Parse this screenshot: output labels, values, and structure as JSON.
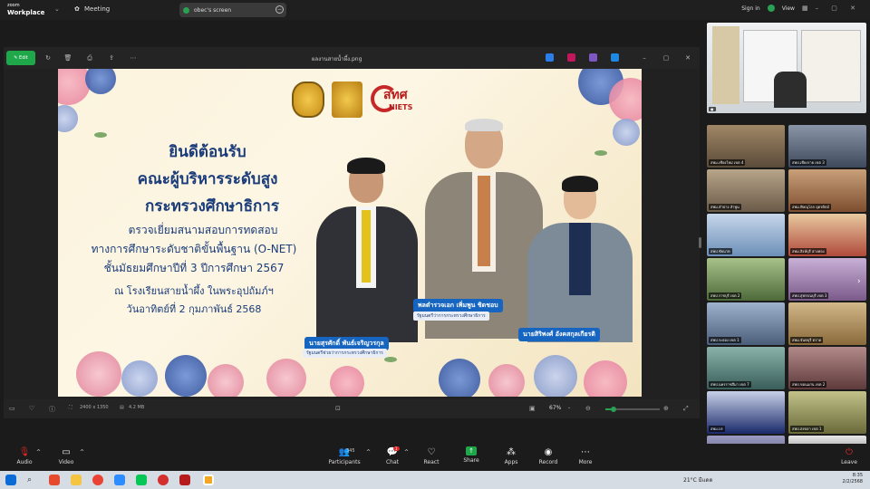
{
  "app": {
    "logo_top": "zoom",
    "logo_name": "Workplace",
    "meeting_label": "Meeting",
    "screen_chip": "obec's screen",
    "sign_in": "Sign in",
    "view": "View"
  },
  "viewer": {
    "edit_label": "Edit",
    "file_title": "ผลงานสายน้ำผึ้ง.png",
    "dimensions": "2400 x 1350",
    "file_size": "4.2 MB",
    "zoom_level": "67%"
  },
  "slide": {
    "line1": "ยินดีต้อนรับ",
    "line2": "คณะผู้บริหารระดับสูง",
    "line3": "กระทรวงศึกษาธิการ",
    "line4": "ตรวจเยี่ยมสนามสอบการทดสอบ",
    "line5": "ทางการศึกษาระดับชาติขั้นพื้นฐาน (O-NET)",
    "line6": "ชั้นมัธยมศึกษาปีที่ 3 ปีการศึกษา 2567",
    "line7": "ณ โรงเรียนสายน้ำผึ้ง ในพระอุปถัมภ์ฯ",
    "line8": "วันอาทิตย์ที่ 2 กุมภาพันธ์ 2568",
    "niets_thai": "สทศ",
    "niets_en": "NIETS",
    "people": [
      {
        "name": "นายสุรศักดิ์ พันธ์เจริญวรกุล",
        "role": "รัฐมนตรีช่วยว่าการกระทรวงศึกษาธิการ"
      },
      {
        "name": "พลตำรวจเอก เพิ่มพูน ชิดชอบ",
        "role": "รัฐมนตรีว่าการกระทรวงศึกษาธิการ"
      },
      {
        "name": "นายสิริพงศ์ อังคสกุลเกียรติ",
        "role": ""
      }
    ]
  },
  "participants": {
    "count": "345",
    "tiles": [
      {
        "label": "สพม.เชียงใหม่ เขต 4"
      },
      {
        "label": "สพป.เชียงราย เขต 3"
      },
      {
        "label": "สพม.ลำปาง ลำพูน"
      },
      {
        "label": "สพม.พิษณุโลก อุตรดิตถ์"
      },
      {
        "label": "สพป.ชัยนาท"
      },
      {
        "label": "สพม.สิงห์บุรี อ่างทอง"
      },
      {
        "label": "สพป.ราชบุรี เขต 2"
      },
      {
        "label": "สพป.สุพรรณบุรี เขต 3"
      },
      {
        "label": "สพป.ระยอง เขต 1"
      },
      {
        "label": "สพม.จันทบุรี ตราด"
      },
      {
        "label": "สพป.นครราชสีมา เขต 7"
      },
      {
        "label": "สพป.ขอนแก่น เขต 2"
      },
      {
        "label": "สพม.บร"
      },
      {
        "label": "สพป.สงขลา เขต 1"
      },
      {
        "label": "สพป.ยะลา เขต 1"
      },
      {
        "label": "สพม.นราธิวาส"
      }
    ]
  },
  "controls": {
    "audio": "Audio",
    "video": "Video",
    "participants": "Participants",
    "chat": "Chat",
    "chat_badge": "1",
    "react": "React",
    "share": "Share",
    "apps": "Apps",
    "record": "Record",
    "more": "More",
    "leave": "Leave"
  },
  "taskbar": {
    "weather": "21°C มีแดด",
    "time": "8:35",
    "date": "2/2/2568"
  }
}
